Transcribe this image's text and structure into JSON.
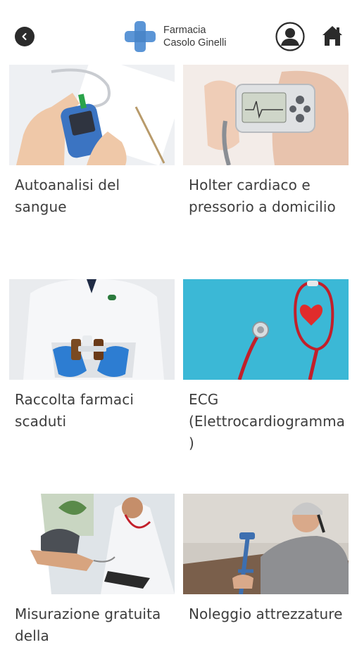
{
  "header": {
    "brand_line1": "Farmacia",
    "brand_line2": "Casolo Ginelli",
    "back_icon": "chevron-left-icon",
    "user_icon": "user-icon",
    "home_icon": "home-icon",
    "accent_color": "#5b95d6"
  },
  "services": [
    {
      "label": "Autoanalisi del sangue",
      "image": "blood-glucose-meter-photo"
    },
    {
      "label": "Holter cardiaco e pressorio a domicilio",
      "image": "holter-monitor-photo"
    },
    {
      "label": "Raccolta farmaci scaduti",
      "image": "expired-medicines-collection-photo"
    },
    {
      "label": "ECG (Elettrocardiogramma)",
      "image": "stethoscope-heart-photo"
    },
    {
      "label": "Misurazione gratuita della",
      "image": "blood-pressure-measurement-photo"
    },
    {
      "label": "Noleggio attrezzature",
      "image": "crutch-rental-photo"
    }
  ]
}
